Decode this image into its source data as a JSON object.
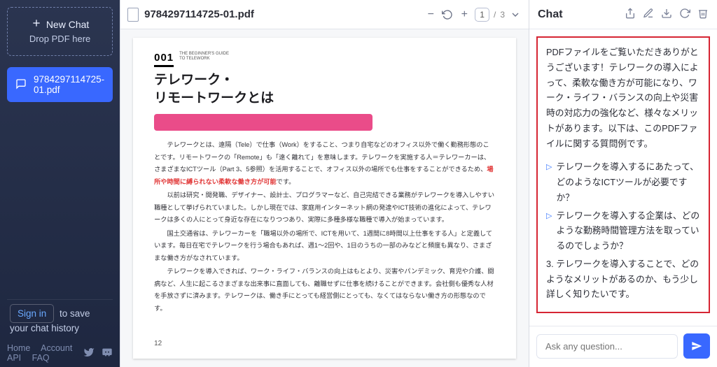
{
  "sidebar": {
    "new_chat": "New Chat",
    "drop_pdf": "Drop PDF here",
    "active_item": "9784297114725-01.pdf",
    "signin": "Sign in",
    "signin_suffix": " to save your chat history",
    "footer": {
      "home": "Home",
      "account": "Account",
      "api": "API",
      "faq": "FAQ"
    }
  },
  "pdf": {
    "filename": "9784297114725-01.pdf",
    "page_current": "1",
    "page_sep": "/",
    "page_total": "3",
    "chapter_no": "001",
    "chapter_sub1": "THE BEGINNER'S GUIDE",
    "chapter_sub2": "TO TELEWORK",
    "title1": "テレワーク・",
    "title2": "リモートワークとは",
    "para1": "　テレワークとは、遠隔（Tele）で仕事（Work）をすること、つまり自宅などのオフィス以外で働く勤務形態のことです。リモートワークの「Remote」も「遠く離れて」を意味します。テレワークを実施する人＝テレワーカーは、さまざまなICTツール（Part 3、5参照）を活用することで、オフィス以外の場所でも仕事をすることができるため、",
    "para1_hl": "場所や時間に縛られない柔軟な働き方が可能",
    "para1_end": "です。",
    "para2": "　以前は研究・開発職、デザイナー、設計士、プログラマーなど、自己完結できる業務がテレワークを導入しやすい職種として挙げられていました。しかし現在では、家庭用インターネット網の発達やICT技術の進化によって、テレワークは多くの人にとって身近な存在になりつつあり、実際に多種多様な職種で導入が始まっています。",
    "para3": "　国土交通省は、テレワーカーを「職場以外の場所で、ICTを用いて、1週間に8時間以上仕事をする人」と定義しています。毎日在宅でテレワークを行う場合もあれば、週1～2回や、1日のうちの一部のみなどと頻度も異なり、さまざまな働き方がなされています。",
    "para4": "　テレワークを導入できれば、ワーク・ライフ・バランスの向上はもとより、災害やパンデミック、育児や介護、闘病など、人生に起こるさまざまな出来事に直面しても、離職せずに仕事を続けることができます。会社側も優秀な人材を手放さずに済みます。テレワークは、働き手にとっても経営側にとっても、なくてはならない働き方の形態なのです。",
    "page_number": "12"
  },
  "chat": {
    "title": "Chat",
    "intro": "PDFファイルをご覧いただきありがとうございます！テレワークの導入によって、柔軟な働き方が可能になり、ワーク・ライフ・バランスの向上や災害時の対応力の強化など、様々なメリットがあります。以下は、このPDFファイルに関する質問例です。",
    "s1": "テレワークを導入するにあたって、どのようなICTツールが必要ですか？",
    "s2": "テレワークを導入する企業は、どのような勤務時間管理方法を取っているのでしょうか？",
    "s3_prefix": "3. ",
    "s3": "テレワークを導入することで、どのようなメリットがあるのか、もう少し詳しく知りたいです。",
    "placeholder": "Ask any question..."
  }
}
